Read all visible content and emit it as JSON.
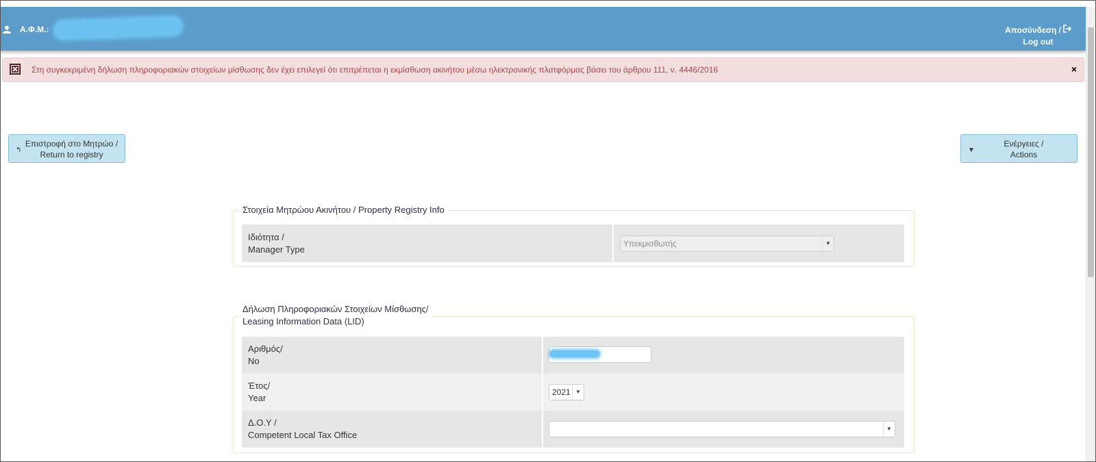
{
  "header": {
    "afm_label": "Α.Φ.Μ.:",
    "logout_line1": "Αποσύνδεση /",
    "logout_line2": "Log out"
  },
  "alert": {
    "message": "Στη συγκεκριμένη δήλωση πληροφοριακών στοιχείων μίσθωσης δεν έχει επιλεγεί ότι επιτρέπεται η εκμίσθωση ακινήτου μέσω ηλεκτρονικής πλατφόρμας βάσει του άρθρου 111, ν. 4446/2016",
    "close": "×"
  },
  "buttons": {
    "return_line1": "Επιστροφή στο Μητρώο /",
    "return_line2": "Return to registry",
    "actions_line1": "Ενέργειες /",
    "actions_line2": "Actions"
  },
  "property_registry": {
    "legend": "Στοιχεία Μητρώου Ακινήτου / Property Registry Info",
    "manager_type_label_gr": "Ιδιότητα /",
    "manager_type_label_en": "Manager Type",
    "manager_type_value": "Υπεκμισθωτής"
  },
  "lid": {
    "legend_line1": "Δήλωση Πληροφοριακών Στοιχείων Μίσθωσης/",
    "legend_line2": "Leasing Information Data (LID)",
    "no_label_gr": "Αριθμός/",
    "no_label_en": "No",
    "year_label_gr": "Έτος/",
    "year_label_en": "Year",
    "year_value": "2021",
    "tax_office_label_gr": "Δ.Ο.Υ /",
    "tax_office_label_en": "Competent Local Tax Office",
    "tax_office_value": ""
  },
  "colors": {
    "header_bg": "#5b9ccb",
    "alert_bg": "#f2dede",
    "alert_text": "#a94442",
    "button_bg": "#c4e3f0"
  }
}
